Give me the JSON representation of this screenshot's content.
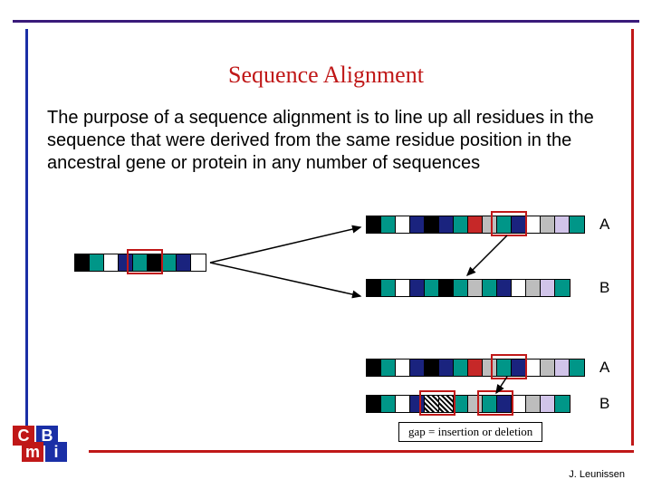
{
  "title": "Sequence Alignment",
  "body": "The purpose of a sequence alignment is to line up all residues in the sequence that were derived from the same residue position in the ancestral gene or protein in any number of sequences",
  "labels": {
    "A": "A",
    "B": "B"
  },
  "gap_note": "gap = insertion or deletion",
  "footer": "J. Leunissen",
  "logo": {
    "c": "C",
    "b": "B",
    "m": "m",
    "i": "i"
  },
  "ancestor_colors": [
    "black",
    "teal",
    "white",
    "navy",
    "teal",
    "black",
    "teal",
    "navy",
    "white"
  ],
  "seqA_colors": [
    "black",
    "teal",
    "white",
    "navy",
    "black",
    "navy",
    "teal",
    "red",
    "grey",
    "teal",
    "navy",
    "white",
    "grey",
    "lav",
    "teal"
  ],
  "seqB_colors": [
    "black",
    "teal",
    "white",
    "navy",
    "teal",
    "black",
    "teal",
    "grey",
    "teal",
    "navy",
    "white",
    "grey",
    "lav",
    "teal"
  ],
  "seqA2_colors": [
    "black",
    "teal",
    "white",
    "navy",
    "black",
    "navy",
    "teal",
    "red",
    "grey",
    "teal",
    "navy",
    "white",
    "grey",
    "lav",
    "teal"
  ],
  "seqB2_colors": [
    "black",
    "teal",
    "white",
    "navy",
    "hatch",
    "hatch",
    "teal",
    "grey",
    "teal",
    "navy",
    "white",
    "grey",
    "lav",
    "teal"
  ],
  "color_map": {
    "black": "c-black",
    "teal": "c-teal",
    "navy": "c-navy",
    "white": "c-white",
    "grey": "c-grey",
    "red": "c-red",
    "lav": "c-lav",
    "hatch": "c-hatch"
  }
}
